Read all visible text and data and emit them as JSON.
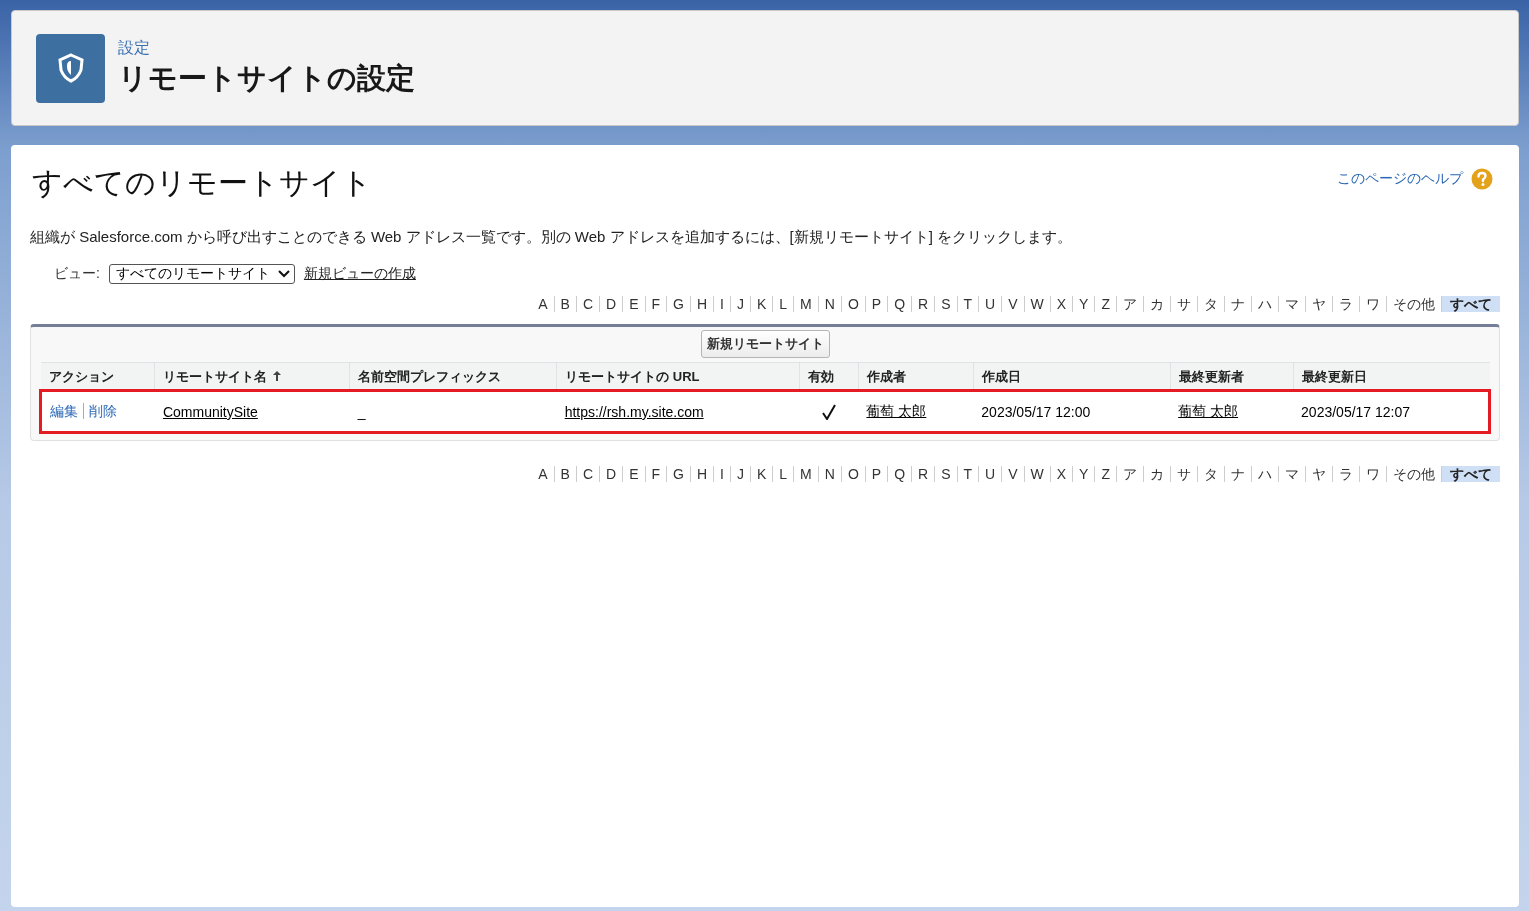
{
  "header": {
    "breadcrumb": "設定",
    "title": "リモートサイトの設定"
  },
  "main": {
    "title": "すべてのリモートサイト",
    "help_link": "このページのヘルプ",
    "description": "組織が Salesforce.com から呼び出すことのできる Web アドレス一覧です。別の Web アドレスを追加するには、[新規リモートサイト] をクリックします。",
    "view": {
      "label": "ビュー:",
      "selected_option": "すべてのリモートサイト",
      "create_link": "新規ビューの作成"
    },
    "alpha_bar_top": [
      {
        "label": "A",
        "selected": false
      },
      {
        "label": "B",
        "selected": false
      },
      {
        "label": "C",
        "selected": false
      },
      {
        "label": "D",
        "selected": false
      },
      {
        "label": "E",
        "selected": false
      },
      {
        "label": "F",
        "selected": false
      },
      {
        "label": "G",
        "selected": false
      },
      {
        "label": "H",
        "selected": false
      },
      {
        "label": "I",
        "selected": false
      },
      {
        "label": "J",
        "selected": false
      },
      {
        "label": "K",
        "selected": false
      },
      {
        "label": "L",
        "selected": false
      },
      {
        "label": "M",
        "selected": false
      },
      {
        "label": "N",
        "selected": false
      },
      {
        "label": "O",
        "selected": false
      },
      {
        "label": "P",
        "selected": false
      },
      {
        "label": "Q",
        "selected": false
      },
      {
        "label": "R",
        "selected": false
      },
      {
        "label": "S",
        "selected": false
      },
      {
        "label": "T",
        "selected": false
      },
      {
        "label": "U",
        "selected": false
      },
      {
        "label": "V",
        "selected": false
      },
      {
        "label": "W",
        "selected": false
      },
      {
        "label": "X",
        "selected": false
      },
      {
        "label": "Y",
        "selected": false
      },
      {
        "label": "Z",
        "selected": false
      },
      {
        "label": "ア",
        "selected": false
      },
      {
        "label": "カ",
        "selected": false
      },
      {
        "label": "サ",
        "selected": false
      },
      {
        "label": "タ",
        "selected": false
      },
      {
        "label": "ナ",
        "selected": false
      },
      {
        "label": "ハ",
        "selected": false
      },
      {
        "label": "マ",
        "selected": false
      },
      {
        "label": "ヤ",
        "selected": false
      },
      {
        "label": "ラ",
        "selected": false
      },
      {
        "label": "ワ",
        "selected": false
      },
      {
        "label": "その他",
        "selected": false
      },
      {
        "label": "すべて",
        "selected": true
      }
    ],
    "new_button": "新規リモートサイト",
    "table": {
      "columns": [
        {
          "label": "アクション",
          "sorted": false
        },
        {
          "label": "リモートサイト名",
          "sorted": true
        },
        {
          "label": "名前空間プレフィックス",
          "sorted": false
        },
        {
          "label": "リモートサイトの URL",
          "sorted": false
        },
        {
          "label": "有効",
          "sorted": false
        },
        {
          "label": "作成者",
          "sorted": false
        },
        {
          "label": "作成日",
          "sorted": false
        },
        {
          "label": "最終更新者",
          "sorted": false
        },
        {
          "label": "最終更新日",
          "sorted": false
        }
      ],
      "rows": [
        {
          "highlighted": true,
          "actions": [
            "編集",
            "削除"
          ],
          "name": "CommunitySite",
          "namespace": "_",
          "url": "https://rsh.my.site.com",
          "active": true,
          "created_by": "葡萄 太郎",
          "created_date": "2023/05/17 12:00",
          "modified_by": "葡萄 太郎",
          "modified_date": "2023/05/17 12:07"
        }
      ]
    },
    "alpha_bar_bottom": [
      {
        "label": "A",
        "selected": false
      },
      {
        "label": "B",
        "selected": false
      },
      {
        "label": "C",
        "selected": false
      },
      {
        "label": "D",
        "selected": false
      },
      {
        "label": "E",
        "selected": false
      },
      {
        "label": "F",
        "selected": false
      },
      {
        "label": "G",
        "selected": false
      },
      {
        "label": "H",
        "selected": false
      },
      {
        "label": "I",
        "selected": false
      },
      {
        "label": "J",
        "selected": false
      },
      {
        "label": "K",
        "selected": false
      },
      {
        "label": "L",
        "selected": false
      },
      {
        "label": "M",
        "selected": false
      },
      {
        "label": "N",
        "selected": false
      },
      {
        "label": "O",
        "selected": false
      },
      {
        "label": "P",
        "selected": false
      },
      {
        "label": "Q",
        "selected": false
      },
      {
        "label": "R",
        "selected": false
      },
      {
        "label": "S",
        "selected": false
      },
      {
        "label": "T",
        "selected": false
      },
      {
        "label": "U",
        "selected": false
      },
      {
        "label": "V",
        "selected": false
      },
      {
        "label": "W",
        "selected": false
      },
      {
        "label": "X",
        "selected": false
      },
      {
        "label": "Y",
        "selected": false
      },
      {
        "label": "Z",
        "selected": false
      },
      {
        "label": "ア",
        "selected": false
      },
      {
        "label": "カ",
        "selected": false
      },
      {
        "label": "サ",
        "selected": false
      },
      {
        "label": "タ",
        "selected": false
      },
      {
        "label": "ナ",
        "selected": false
      },
      {
        "label": "ハ",
        "selected": false
      },
      {
        "label": "マ",
        "selected": false
      },
      {
        "label": "ヤ",
        "selected": false
      },
      {
        "label": "ラ",
        "selected": false
      },
      {
        "label": "ワ",
        "selected": false
      },
      {
        "label": "その他",
        "selected": false
      },
      {
        "label": "すべて",
        "selected": true
      }
    ]
  }
}
